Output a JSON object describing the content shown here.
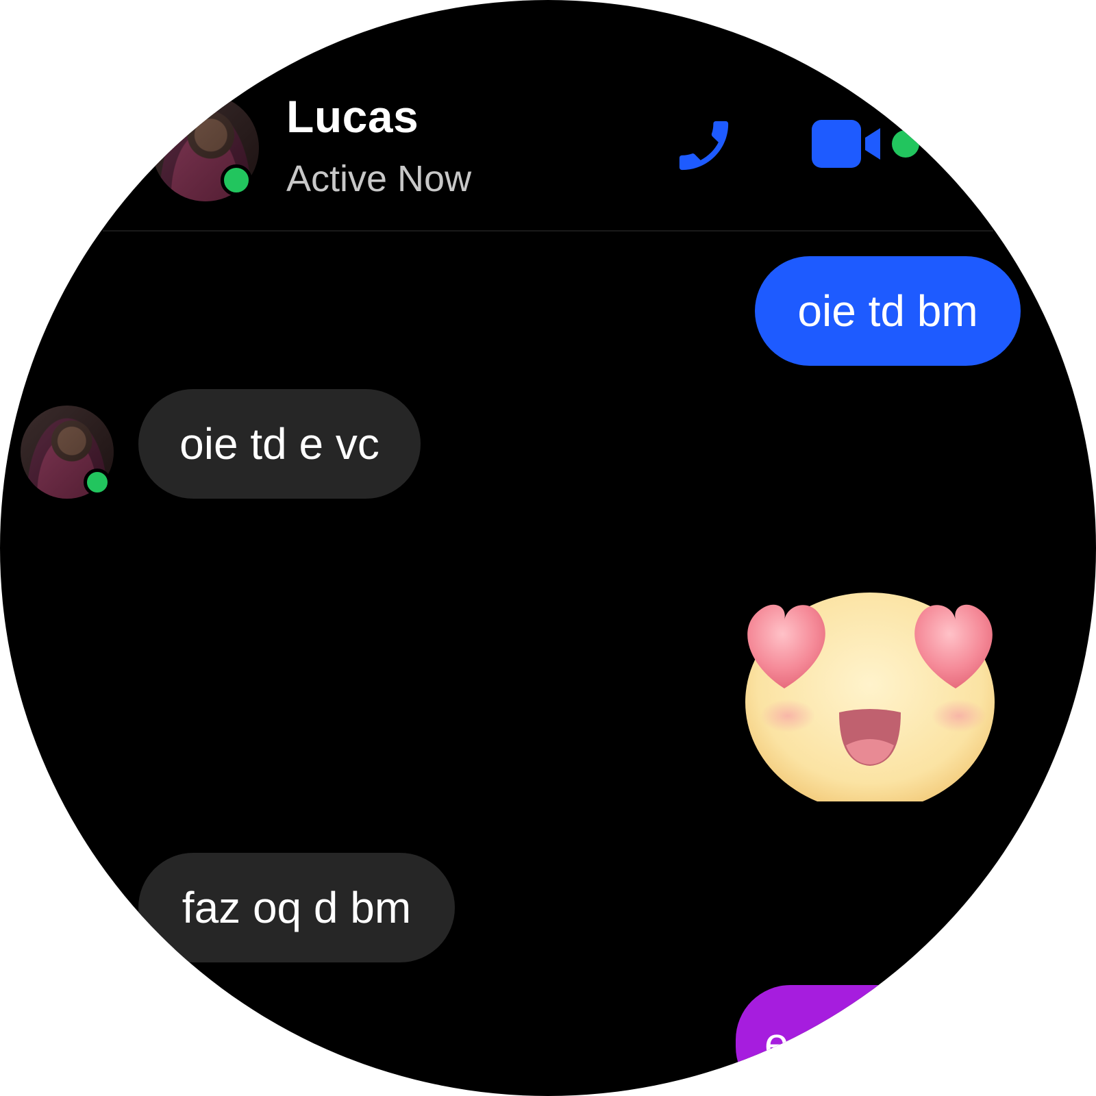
{
  "header": {
    "contact_name": "Lucas",
    "status": "Active Now"
  },
  "icons": {
    "call": "phone-icon",
    "video": "video-camera-icon"
  },
  "colors": {
    "accent_blue": "#1e5bff",
    "received_bubble": "#262626",
    "presence_green": "#22c55e",
    "purple_bubble": "#a61dde"
  },
  "messages": [
    {
      "direction": "sent",
      "text": "oie td bm"
    },
    {
      "direction": "received",
      "text": "oie td e vc"
    },
    {
      "direction": "sent",
      "emoji": "heart-eyes-emoji"
    },
    {
      "direction": "received",
      "text": "faz oq d bm"
    },
    {
      "direction": "sent",
      "text": "e"
    }
  ]
}
